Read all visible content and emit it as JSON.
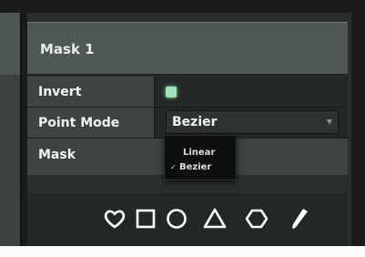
{
  "inspector": {
    "header": {
      "title": "Mask 1"
    },
    "properties": {
      "invert": {
        "label": "Invert",
        "checked": true,
        "color": "#9ee3b8"
      },
      "point_mode": {
        "label": "Point Mode",
        "value": "Bezier"
      }
    },
    "mask_section": {
      "label": "Mask"
    },
    "dropdown": {
      "options": [
        {
          "label": "Linear",
          "selected": false
        },
        {
          "label": "Bezier",
          "selected": true,
          "check": "✓"
        }
      ]
    },
    "tools": [
      {
        "icon": "heart-icon"
      },
      {
        "icon": "square-icon"
      },
      {
        "icon": "circle-icon"
      },
      {
        "icon": "triangle-icon"
      },
      {
        "icon": "hexagon-icon"
      },
      {
        "icon": "pencil-icon"
      }
    ]
  }
}
